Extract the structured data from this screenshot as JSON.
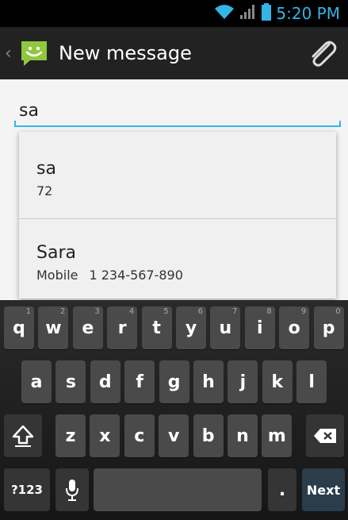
{
  "status_bar": {
    "time": "5:20 PM",
    "wifi_icon": "wifi-icon",
    "signal_icon": "signal-icon",
    "battery_icon": "battery-icon",
    "accent_color": "#33b5e5"
  },
  "action_bar": {
    "title": "New message",
    "up_icon": "chevron-left-icon",
    "app_icon": "messaging-smiley-icon",
    "attach_icon": "paperclip-icon"
  },
  "to_field": {
    "value": "sa"
  },
  "suggestions": [
    {
      "name": "sa",
      "detail_label": "",
      "detail": "72"
    },
    {
      "name": "Sara",
      "detail_label": "Mobile",
      "detail": "1 234-567-890"
    }
  ],
  "keyboard": {
    "row1": [
      {
        "label": "q",
        "hint": "1"
      },
      {
        "label": "w",
        "hint": "2"
      },
      {
        "label": "e",
        "hint": "3"
      },
      {
        "label": "r",
        "hint": "4"
      },
      {
        "label": "t",
        "hint": "5"
      },
      {
        "label": "y",
        "hint": "6"
      },
      {
        "label": "u",
        "hint": "7"
      },
      {
        "label": "i",
        "hint": "8"
      },
      {
        "label": "o",
        "hint": "9"
      },
      {
        "label": "p",
        "hint": "0"
      }
    ],
    "row2": [
      "a",
      "s",
      "d",
      "f",
      "g",
      "h",
      "j",
      "k",
      "l"
    ],
    "row3": [
      "z",
      "x",
      "c",
      "v",
      "b",
      "n",
      "m"
    ],
    "shift_icon": "shift-icon",
    "delete_icon": "backspace-icon",
    "symbols_label": "?123",
    "mic_icon": "microphone-icon",
    "period_label": ".",
    "next_label": "Next"
  }
}
